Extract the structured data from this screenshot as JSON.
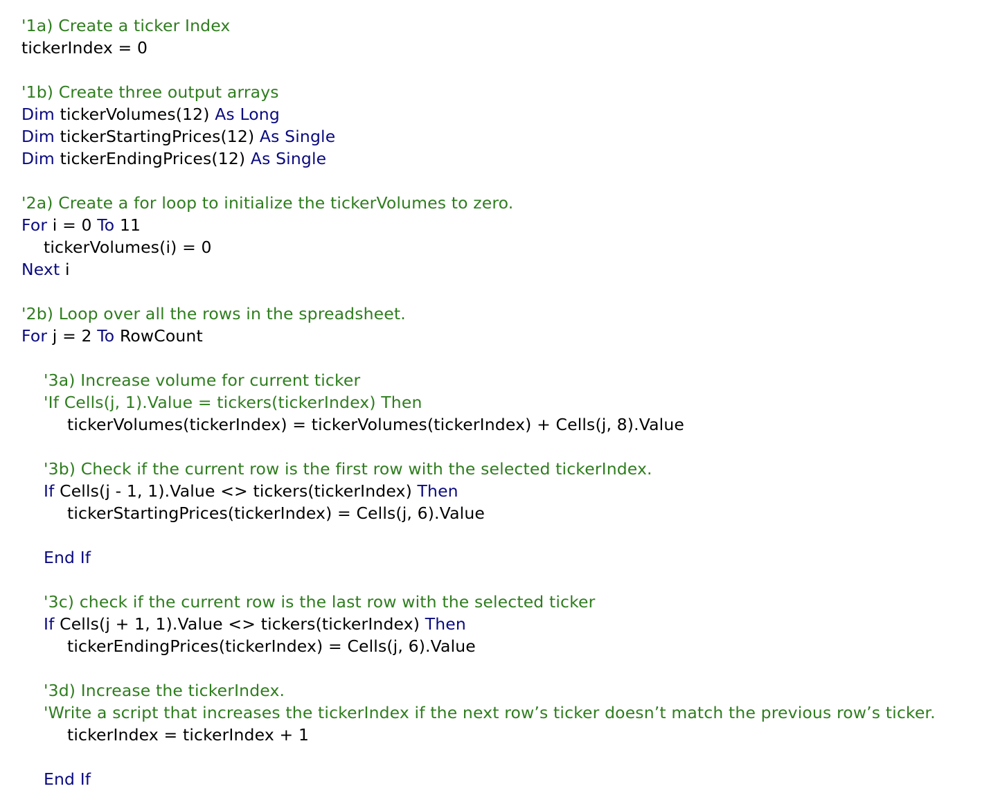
{
  "colors": {
    "comment": "#2e7d1e",
    "keyword": "#0a0a80",
    "plain": "#000000",
    "background": "#ffffff"
  },
  "code_lines": [
    {
      "indent": 0,
      "tokens": [
        {
          "t": "comment",
          "v": "'1a) Create a ticker Index"
        }
      ]
    },
    {
      "indent": 0,
      "tokens": [
        {
          "t": "plain",
          "v": "tickerIndex = 0"
        }
      ]
    },
    {
      "indent": 0,
      "tokens": []
    },
    {
      "indent": 0,
      "tokens": [
        {
          "t": "comment",
          "v": "'1b) Create three output arrays"
        }
      ]
    },
    {
      "indent": 0,
      "tokens": [
        {
          "t": "keyword",
          "v": "Dim"
        },
        {
          "t": "plain",
          "v": " tickerVolumes(12) "
        },
        {
          "t": "keyword",
          "v": "As Long"
        }
      ]
    },
    {
      "indent": 0,
      "tokens": [
        {
          "t": "keyword",
          "v": "Dim"
        },
        {
          "t": "plain",
          "v": " tickerStartingPrices(12) "
        },
        {
          "t": "keyword",
          "v": "As Single"
        }
      ]
    },
    {
      "indent": 0,
      "tokens": [
        {
          "t": "keyword",
          "v": "Dim"
        },
        {
          "t": "plain",
          "v": " tickerEndingPrices(12) "
        },
        {
          "t": "keyword",
          "v": "As Single"
        }
      ]
    },
    {
      "indent": 0,
      "tokens": []
    },
    {
      "indent": 0,
      "tokens": [
        {
          "t": "comment",
          "v": "'2a) Create a for loop to initialize the tickerVolumes to zero."
        }
      ]
    },
    {
      "indent": 0,
      "tokens": [
        {
          "t": "keyword",
          "v": "For"
        },
        {
          "t": "plain",
          "v": " i = 0 "
        },
        {
          "t": "keyword",
          "v": "To"
        },
        {
          "t": "plain",
          "v": " 11"
        }
      ]
    },
    {
      "indent": 1,
      "tokens": [
        {
          "t": "plain",
          "v": "tickerVolumes(i) = 0"
        }
      ]
    },
    {
      "indent": 0,
      "tokens": [
        {
          "t": "keyword",
          "v": "Next"
        },
        {
          "t": "plain",
          "v": " i"
        }
      ]
    },
    {
      "indent": 0,
      "tokens": []
    },
    {
      "indent": 0,
      "tokens": [
        {
          "t": "comment",
          "v": "'2b) Loop over all the rows in the spreadsheet."
        }
      ]
    },
    {
      "indent": 0,
      "tokens": [
        {
          "t": "keyword",
          "v": "For"
        },
        {
          "t": "plain",
          "v": " j = 2 "
        },
        {
          "t": "keyword",
          "v": "To"
        },
        {
          "t": "plain",
          "v": " RowCount"
        }
      ]
    },
    {
      "indent": 0,
      "tokens": []
    },
    {
      "indent": 1,
      "tokens": [
        {
          "t": "comment",
          "v": "'3a) Increase volume for current ticker"
        }
      ]
    },
    {
      "indent": 1,
      "tokens": [
        {
          "t": "comment",
          "v": "'If Cells(j, 1).Value = tickers(tickerIndex) Then"
        }
      ]
    },
    {
      "indent": 2,
      "tokens": [
        {
          "t": "plain",
          "v": "tickerVolumes(tickerIndex) = tickerVolumes(tickerIndex) + Cells(j, 8).Value"
        }
      ]
    },
    {
      "indent": 0,
      "tokens": []
    },
    {
      "indent": 1,
      "tokens": [
        {
          "t": "comment",
          "v": "'3b) Check if the current row is the first row with the selected tickerIndex."
        }
      ]
    },
    {
      "indent": 1,
      "tokens": [
        {
          "t": "keyword",
          "v": "If"
        },
        {
          "t": "plain",
          "v": " Cells(j - 1, 1).Value <> tickers(tickerIndex) "
        },
        {
          "t": "keyword",
          "v": "Then"
        }
      ]
    },
    {
      "indent": 2,
      "tokens": [
        {
          "t": "plain",
          "v": "tickerStartingPrices(tickerIndex) = Cells(j, 6).Value"
        }
      ]
    },
    {
      "indent": 0,
      "tokens": []
    },
    {
      "indent": 1,
      "tokens": [
        {
          "t": "keyword",
          "v": "End If"
        }
      ]
    },
    {
      "indent": 0,
      "tokens": []
    },
    {
      "indent": 1,
      "tokens": [
        {
          "t": "comment",
          "v": "'3c) check if the current row is the last row with the selected ticker"
        }
      ]
    },
    {
      "indent": 1,
      "tokens": [
        {
          "t": "keyword",
          "v": "If"
        },
        {
          "t": "plain",
          "v": " Cells(j + 1, 1).Value <> tickers(tickerIndex) "
        },
        {
          "t": "keyword",
          "v": "Then"
        }
      ]
    },
    {
      "indent": 2,
      "tokens": [
        {
          "t": "plain",
          "v": "tickerEndingPrices(tickerIndex) = Cells(j, 6).Value"
        }
      ]
    },
    {
      "indent": 0,
      "tokens": []
    },
    {
      "indent": 1,
      "tokens": [
        {
          "t": "comment",
          "v": "'3d) Increase the tickerIndex."
        }
      ]
    },
    {
      "indent": 1,
      "tokens": [
        {
          "t": "comment",
          "v": "'Write a script that increases the tickerIndex if the next row’s ticker doesn’t match the previous row’s ticker."
        }
      ]
    },
    {
      "indent": 2,
      "tokens": [
        {
          "t": "plain",
          "v": "tickerIndex = tickerIndex + 1"
        }
      ]
    },
    {
      "indent": 0,
      "tokens": []
    },
    {
      "indent": 1,
      "tokens": [
        {
          "t": "keyword",
          "v": "End If"
        }
      ]
    }
  ]
}
